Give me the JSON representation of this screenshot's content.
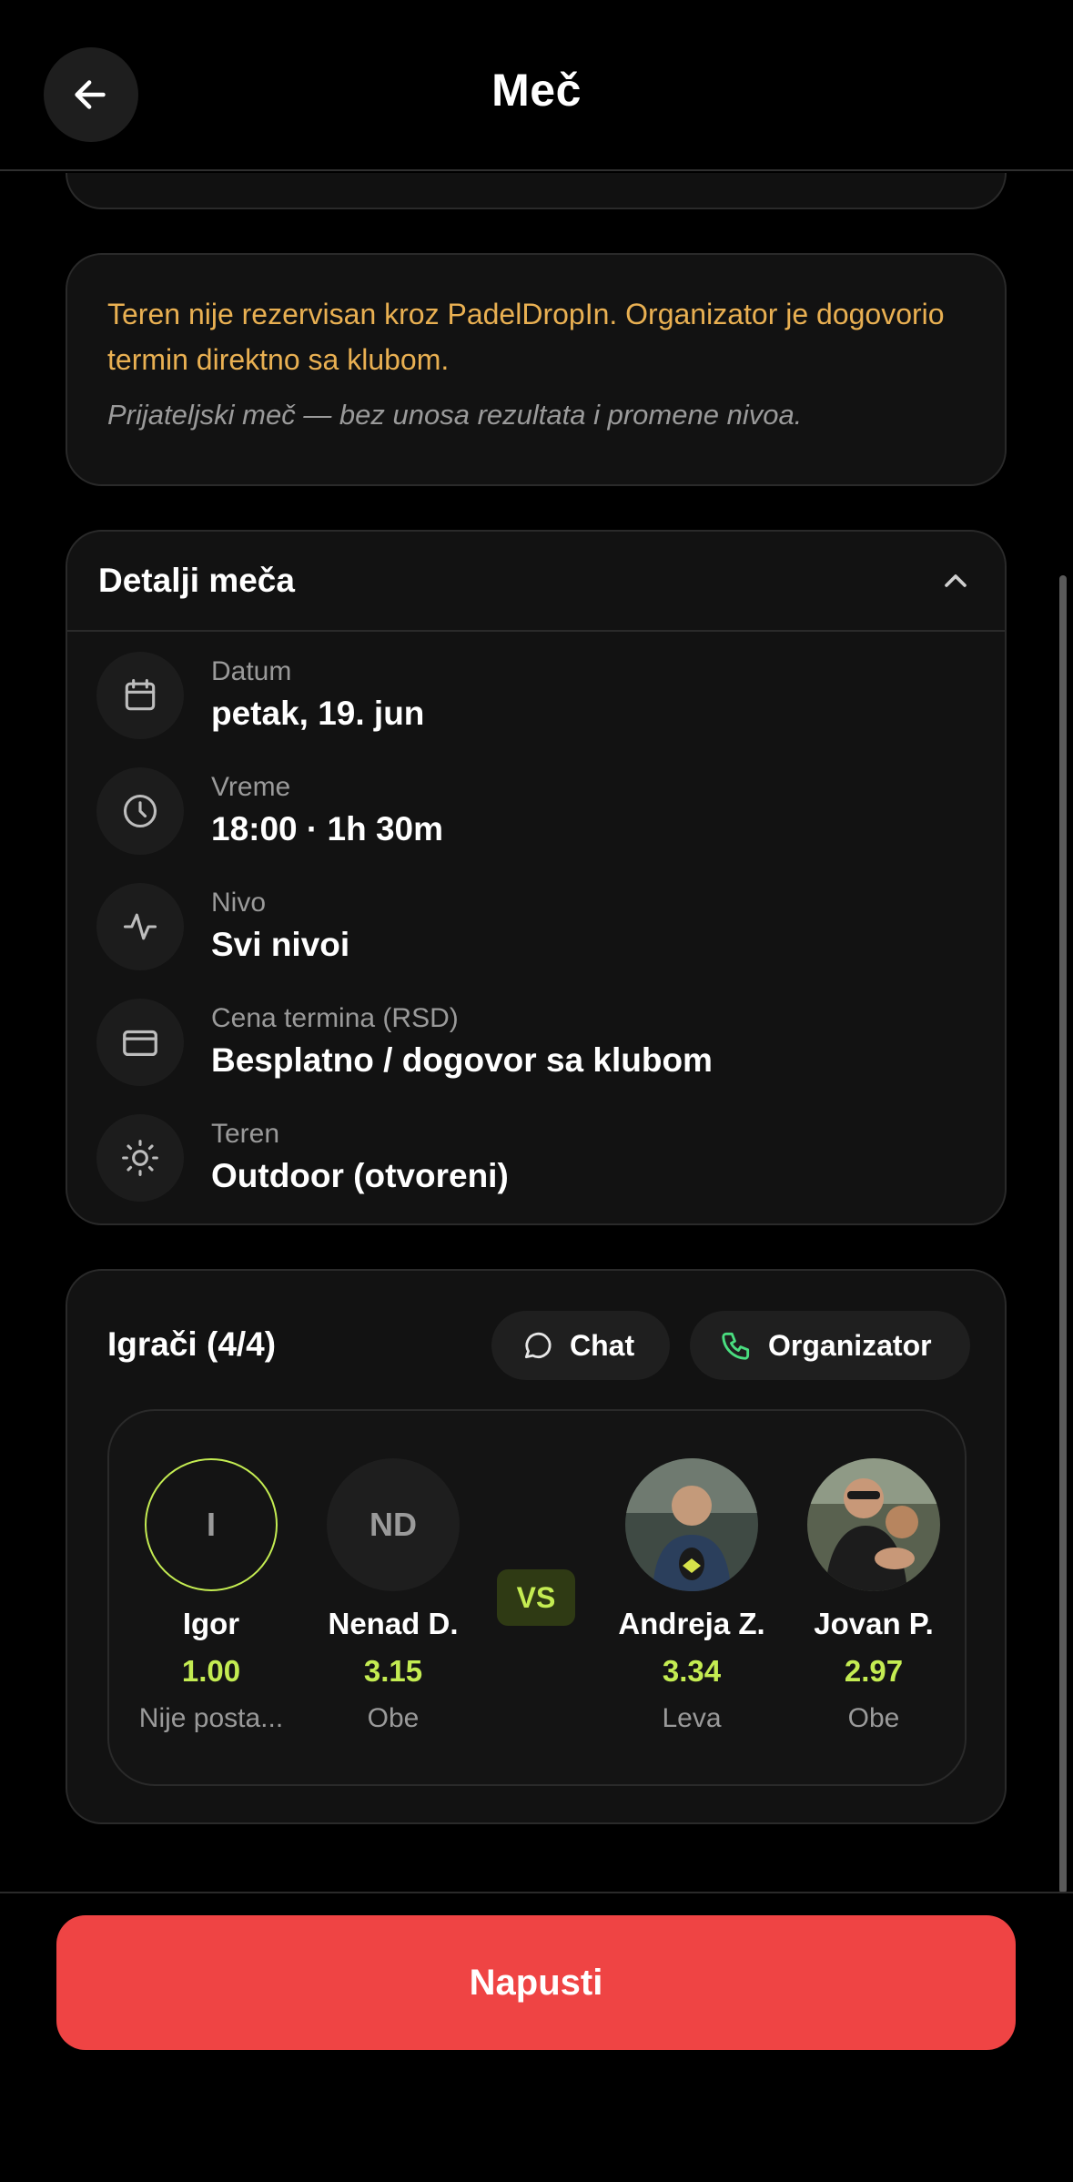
{
  "header": {
    "title": "Meč"
  },
  "notice": {
    "warning": "Teren nije rezervisan kroz PadelDropIn. Organizator je dogovorio termin direktno sa klubom.",
    "friendly": "Prijateljski meč — bez unosa rezultata i promene nivoa."
  },
  "details": {
    "title": "Detalji meča",
    "rows": [
      {
        "icon": "calendar-icon",
        "label": "Datum",
        "value": "petak, 19. jun"
      },
      {
        "icon": "clock-icon",
        "label": "Vreme",
        "value": "18:00 · 1h 30m"
      },
      {
        "icon": "activity-icon",
        "label": "Nivo",
        "value": "Svi nivoi"
      },
      {
        "icon": "card-icon",
        "label": "Cena termina (RSD)",
        "value": "Besplatno / dogovor sa klubom"
      },
      {
        "icon": "sun-icon",
        "label": "Teren",
        "value": "Outdoor (otvoreni)"
      }
    ]
  },
  "players": {
    "title": "Igrači (4/4)",
    "chat_label": "Chat",
    "organizer_label": "Organizator",
    "vs_label": "VS",
    "list": [
      {
        "initials": "I",
        "name": "Igor",
        "rating": "1.00",
        "side": "Nije posta..."
      },
      {
        "initials": "ND",
        "name": "Nenad D.",
        "rating": "3.15",
        "side": "Obe"
      },
      {
        "initials": "",
        "name": "Andreja Z.",
        "rating": "3.34",
        "side": "Leva"
      },
      {
        "initials": "",
        "name": "Jovan P.",
        "rating": "2.97",
        "side": "Obe"
      }
    ]
  },
  "leave_label": "Napusti",
  "colors": {
    "accent": "#c4ec52",
    "warning": "#e9b052",
    "danger": "#ef4444"
  }
}
